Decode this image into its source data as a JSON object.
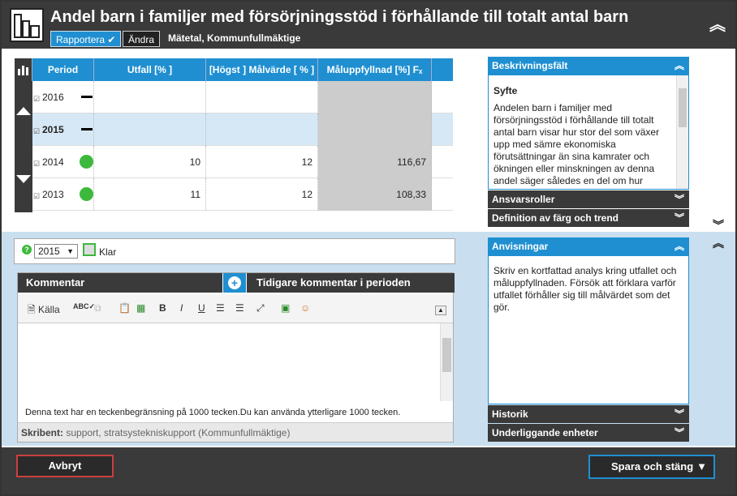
{
  "header": {
    "title": "Andel barn i familjer med försörjningsstöd i förhållande till totalt antal barn",
    "rapportera_label": "Rapportera",
    "andra_label": "Ändra",
    "meta": "Mätetal, Kommunfullmäktige"
  },
  "table": {
    "columns": [
      "Period",
      "Utfall [% ]",
      "[Högst ] Målvärde [ % ]",
      "Måluppfyllnad [%]"
    ],
    "rows": [
      {
        "year": "2016",
        "status": "none",
        "utfall": "",
        "malvarde": "",
        "maluppfyllnad": ""
      },
      {
        "year": "2015",
        "status": "none",
        "utfall": "",
        "malvarde": "",
        "maluppfyllnad": ""
      },
      {
        "year": "2014",
        "status": "green",
        "utfall": "10",
        "malvarde": "12",
        "maluppfyllnad": "116,67"
      },
      {
        "year": "2013",
        "status": "green",
        "utfall": "11",
        "malvarde": "12",
        "maluppfyllnad": "108,33"
      }
    ]
  },
  "panels": {
    "beskrivning": {
      "title": "Beskrivningsfält",
      "heading": "Syfte",
      "text": "Andelen barn i familjer med försörjningsstöd i förhållande till totalt antal barn visar hur stor del som växer upp med sämre ekonomiska förutsättningar än sina kamrater och ökningen eller minskningen av denna andel säger således en del om hur"
    },
    "ansvarsroller": "Ansvarsroller",
    "definition": "Definition av färg och trend",
    "anvisningar": {
      "title": "Anvisningar",
      "text": "Skriv en kortfattad analys kring utfallet och måluppfyllnaden. Försök att förklara varför utfallet förhåller sig till målvärdet som det gör."
    },
    "historik": "Historik",
    "underliggande": "Underliggande enheter"
  },
  "period": {
    "selected_year": "2015",
    "status_label": "Klar"
  },
  "comment": {
    "tab_label": "Kommentar",
    "previous_tab_label": "Tidigare kommentar i perioden",
    "toolbar": {
      "source_label": "Källa",
      "bold": "B",
      "italic": "I",
      "underline": "U"
    },
    "limit_note": "Denna text har en teckenbegränsning på 1000 tecken.Du kan använda ytterligare 1000 tecken.",
    "writer_label": "Skribent:",
    "writer_value": "support, stratsystekniskupport (Kommunfullmäktige)"
  },
  "footer": {
    "cancel_label": "Avbryt",
    "save_label": "Spara och stäng"
  },
  "colors": {
    "accent": "#1f8fd1",
    "dark": "#3a3a3a",
    "status_green": "#3cb93c",
    "cancel_border": "#c94040"
  }
}
